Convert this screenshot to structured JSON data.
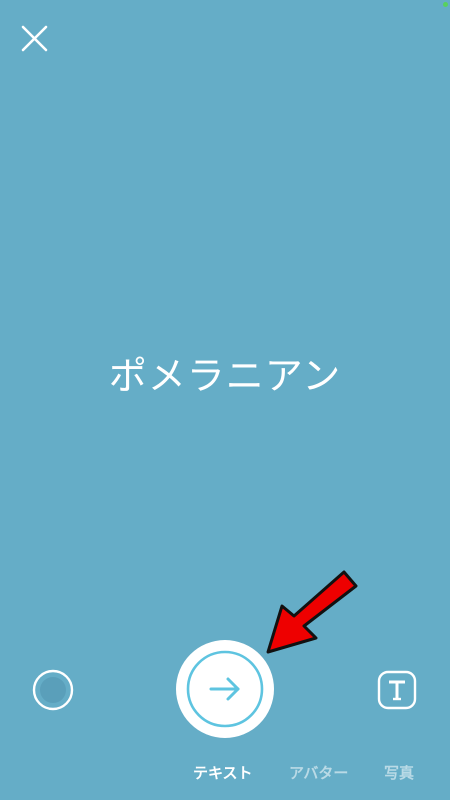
{
  "post": {
    "text": "ポメラニアン",
    "background_color": "#65adc7"
  },
  "toolbar": {
    "close_icon": "close-icon",
    "color_icon": "color-circle-icon",
    "send_icon": "arrow-right-icon",
    "text_style_icon": "text-style-icon"
  },
  "tabs": [
    {
      "label": "テキスト",
      "active": true
    },
    {
      "label": "アバター",
      "active": false
    },
    {
      "label": "写真",
      "active": false
    }
  ],
  "colors": {
    "accent": "#5ec4e0",
    "annotation": "#ee0000"
  }
}
